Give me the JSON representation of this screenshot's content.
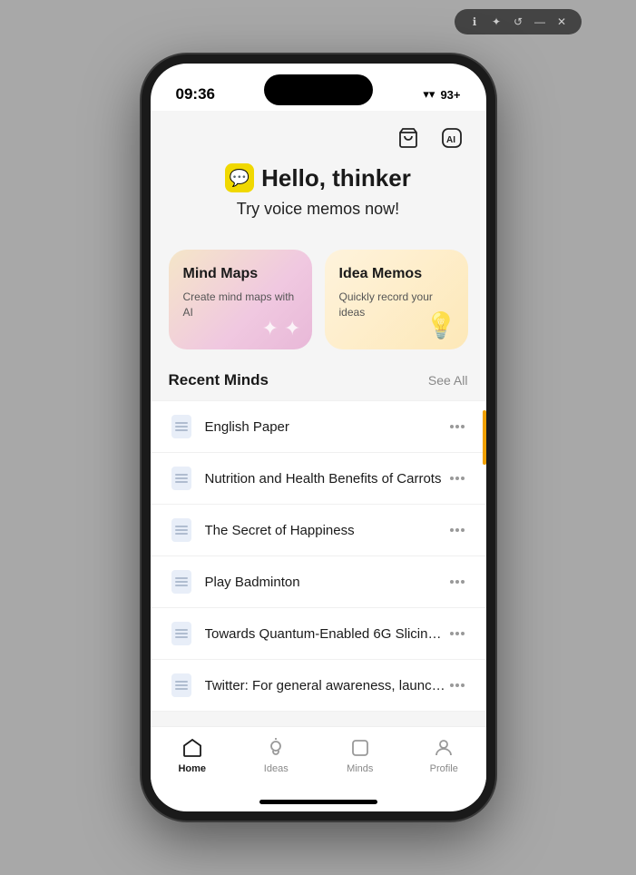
{
  "window": {
    "icons": [
      "ℹ",
      "✦",
      "↺",
      "—",
      "✕"
    ]
  },
  "status_bar": {
    "time": "09:36",
    "wifi": "WiFi",
    "battery": "93+"
  },
  "top_actions": {
    "basket_icon": "🛒",
    "ai_icon": "AI"
  },
  "hero": {
    "greeting_icon": "💬",
    "greeting": "Hello, thinker",
    "subtitle": "Try voice memos now!"
  },
  "cards": [
    {
      "id": "mind-maps",
      "title": "Mind Maps",
      "description": "Create mind maps with AI",
      "decoration": "✦"
    },
    {
      "id": "idea-memos",
      "title": "Idea Memos",
      "description": "Quickly record your ideas",
      "decoration": "💡"
    }
  ],
  "recent_section": {
    "title": "Recent Minds",
    "see_all": "See All"
  },
  "recent_items": [
    {
      "title": "English Paper"
    },
    {
      "title": "Nutrition and Health Benefits of Carrots"
    },
    {
      "title": "The Secret of Happiness"
    },
    {
      "title": "Play Badminton"
    },
    {
      "title": "Towards Quantum-Enabled 6G Slicing-..."
    },
    {
      "title": "Twitter: For general awareness, launch..."
    }
  ],
  "nav": [
    {
      "id": "home",
      "label": "Home",
      "active": true
    },
    {
      "id": "ideas",
      "label": "Ideas",
      "active": false
    },
    {
      "id": "minds",
      "label": "Minds",
      "active": false
    },
    {
      "id": "profile",
      "label": "Profile",
      "active": false
    }
  ]
}
